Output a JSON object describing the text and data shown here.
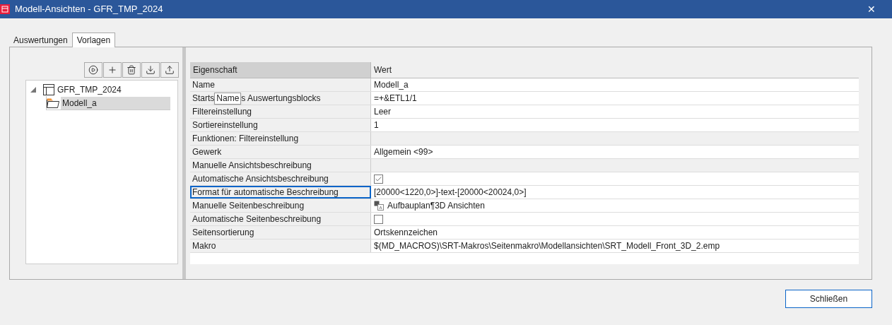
{
  "window": {
    "title": "Modell-Ansichten - GFR_TMP_2024",
    "close": "✕"
  },
  "tabs": [
    {
      "label": "Auswertungen",
      "selected": false
    },
    {
      "label": "Vorlagen",
      "selected": true
    }
  ],
  "toolbar": [
    {
      "kind": "play"
    },
    {
      "kind": "add"
    },
    {
      "kind": "delete"
    },
    {
      "kind": "import"
    },
    {
      "kind": "export"
    }
  ],
  "tree": [
    {
      "label": "GFR_TMP_2024",
      "kind": "template",
      "expanded": true,
      "selected": false,
      "children": [
        {
          "label": "Modell_a",
          "kind": "folder",
          "selected": true
        }
      ]
    }
  ],
  "grid": {
    "columns": [
      "Eigenschaft",
      "Wert"
    ],
    "rows": [
      {
        "property": "Name",
        "kind": "text",
        "value": "Modell_a",
        "selected": false
      },
      {
        "property_parts": [
          "Starts",
          "s Auswertungsblocks"
        ],
        "tooltip": "Name",
        "kind": "text",
        "value": "=+&ETL1/1",
        "selected": false
      },
      {
        "property": "Filtereinstellung",
        "kind": "text",
        "value": "Leer",
        "selected": false
      },
      {
        "property": "Sortiereinstellung",
        "kind": "text",
        "value": "1",
        "selected": false
      },
      {
        "property": "Funktionen: Filtereinstellung",
        "kind": "empty",
        "selected": false
      },
      {
        "property": "Gewerk",
        "kind": "text",
        "value": "Allgemein <99>",
        "selected": false
      },
      {
        "property": "Manuelle Ansichtsbeschreibung",
        "kind": "empty",
        "selected": false
      },
      {
        "property": "Automatische Ansichtsbeschreibung",
        "kind": "checkbox",
        "checked": true,
        "selected": false
      },
      {
        "property": "Format für automatische Beschreibung",
        "kind": "text",
        "value": "[20000<1220,0>]-text-[20000<20024,0>]",
        "selected": true
      },
      {
        "property": "Manuelle Seitenbeschreibung",
        "kind": "icon_text",
        "value": "Aufbauplan¶3D Ansichten",
        "selected": false
      },
      {
        "property": "Automatische Seitenbeschreibung",
        "kind": "checkbox",
        "checked": false,
        "selected": false
      },
      {
        "property": "Seitensortierung",
        "kind": "text",
        "value": "Ortskennzeichen",
        "selected": false
      },
      {
        "property": "Makro",
        "kind": "text",
        "value": "$(MD_MACROS)\\SRT-Makros\\Seitenmakro\\Modellansichten\\SRT_Modell_Front_3D_2.emp",
        "selected": false
      }
    ]
  },
  "buttons": [
    {
      "label": "Schließen"
    }
  ]
}
